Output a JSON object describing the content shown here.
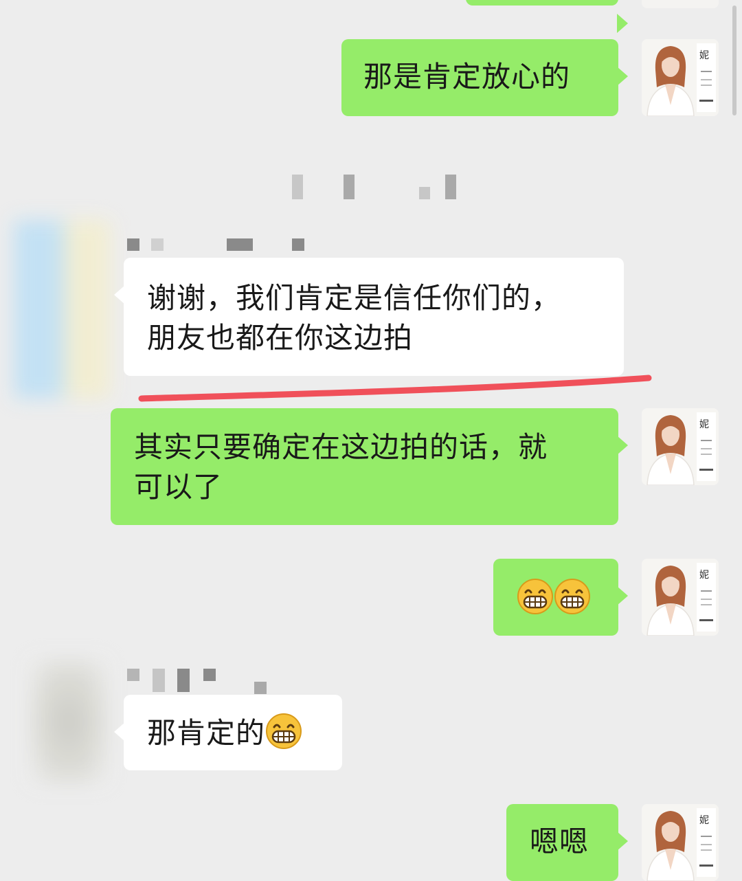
{
  "chat": {
    "messages": [
      {
        "side": "right",
        "text": "那是肯定放心的"
      },
      {
        "side": "left",
        "line1": "谢谢，我们肯定是信任你们的，",
        "line2": "朋友也都在你这边拍"
      },
      {
        "side": "right",
        "line1": "其实只要确定在这边拍的话，就",
        "line2": "可以了"
      },
      {
        "side": "right",
        "emoji": "grinning-face-emoji"
      },
      {
        "side": "left",
        "text": "那肯定的"
      },
      {
        "side": "right",
        "text": "嗯嗯"
      }
    ]
  },
  "colors": {
    "background": "#ededed",
    "outgoing_bubble": "#95ec69",
    "incoming_bubble": "#ffffff",
    "underline": "#f0505a"
  },
  "icons": {
    "emoji": "grinning-face-emoji",
    "avatar": "portrait-avatar"
  }
}
